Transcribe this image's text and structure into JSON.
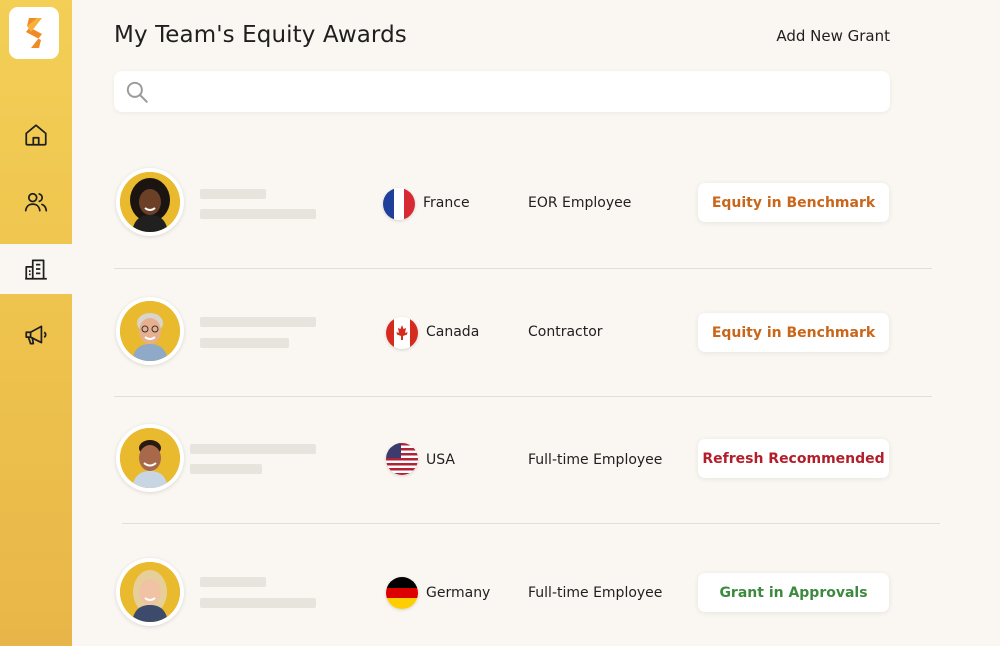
{
  "app": {
    "title": "My Team's Equity Awards"
  },
  "header": {
    "add_grant_label": "Add New Grant"
  },
  "search": {
    "placeholder": ""
  },
  "sidebar": {
    "items": [
      {
        "icon": "home-icon",
        "active": false
      },
      {
        "icon": "people-icon",
        "active": false
      },
      {
        "icon": "building-icon",
        "active": true
      },
      {
        "icon": "megaphone-icon",
        "active": false
      }
    ]
  },
  "colors": {
    "sidebar": "#f0c54f",
    "background": "#faf6f1",
    "status_benchmark": "#c9661a",
    "status_refresh": "#b21f2b",
    "status_approvals": "#3d8a3f"
  },
  "employees": [
    {
      "country": "France",
      "employment_type": "EOR Employee",
      "status": "Equity in Benchmark",
      "status_color": "#c9661a"
    },
    {
      "country": "Canada",
      "employment_type": "Contractor",
      "status": "Equity in Benchmark",
      "status_color": "#c9661a"
    },
    {
      "country": "USA",
      "employment_type": "Full-time Employee",
      "status": "Refresh Recommended",
      "status_color": "#b21f2b"
    },
    {
      "country": "Germany",
      "employment_type": "Full-time Employee",
      "status": "Grant in Approvals",
      "status_color": "#3d8a3f"
    }
  ]
}
